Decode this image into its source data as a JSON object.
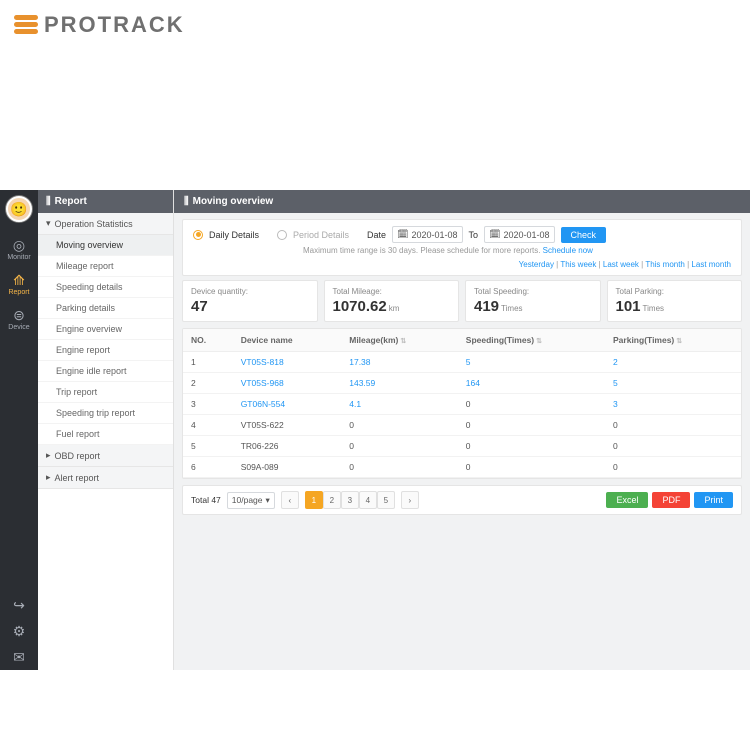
{
  "brand": "PROTRACK",
  "rail": [
    {
      "icon": "◎",
      "label": "Monitor"
    },
    {
      "icon": "⟰",
      "label": "Report"
    },
    {
      "icon": "⊜",
      "label": "Device"
    }
  ],
  "railExtra": [
    "↪",
    "⚙",
    "✉"
  ],
  "side": {
    "title": "Report",
    "grp1": "Operation Statistics",
    "grp2": "OBD report",
    "grp3": "Alert report",
    "items": [
      "Moving overview",
      "Mileage report",
      "Speeding details",
      "Parking details",
      "Engine overview",
      "Engine report",
      "Engine idle report",
      "Trip report",
      "Speeding trip report",
      "Fuel report"
    ]
  },
  "head": "Moving overview",
  "filter": {
    "daily": "Daily Details",
    "period": "Period Details",
    "dateLbl": "Date",
    "toLbl": "To",
    "from": "2020-01-08",
    "to": "2020-01-08",
    "check": "Check",
    "note": "Maximum time range is 30 days. Please schedule for more reports.",
    "sched": "Schedule now",
    "q": [
      "Yesterday",
      "This week",
      "Last week",
      "This month",
      "Last month"
    ]
  },
  "cards": [
    {
      "l": "Device quantity:",
      "v": "47",
      "u": ""
    },
    {
      "l": "Total Mileage:",
      "v": "1070.62",
      "u": "km"
    },
    {
      "l": "Total Speeding:",
      "v": "419",
      "u": "Times"
    },
    {
      "l": "Total Parking:",
      "v": "101",
      "u": "Times"
    }
  ],
  "cols": [
    "NO.",
    "Device name",
    "Mileage(km)",
    "Speeding(Times)",
    "Parking(Times)"
  ],
  "rows": [
    {
      "no": "1",
      "name": "VT05S-818",
      "m": "17.38",
      "s": "5",
      "p": "2",
      "link": true
    },
    {
      "no": "2",
      "name": "VT05S-968",
      "m": "143.59",
      "s": "164",
      "p": "5",
      "link": true
    },
    {
      "no": "3",
      "name": "GT06N-554",
      "m": "4.1",
      "s": "0",
      "p": "3",
      "link": true
    },
    {
      "no": "4",
      "name": "VT05S-622",
      "m": "0",
      "s": "0",
      "p": "0",
      "link": false
    },
    {
      "no": "5",
      "name": "TR06-226",
      "m": "0",
      "s": "0",
      "p": "0",
      "link": false
    },
    {
      "no": "6",
      "name": "S09A-089",
      "m": "0",
      "s": "0",
      "p": "0",
      "link": false
    }
  ],
  "pager": {
    "total": "Total 47",
    "per": "10/page",
    "pages": [
      "1",
      "2",
      "3",
      "4",
      "5"
    ]
  },
  "export": {
    "excel": "Excel",
    "pdf": "PDF",
    "print": "Print"
  }
}
